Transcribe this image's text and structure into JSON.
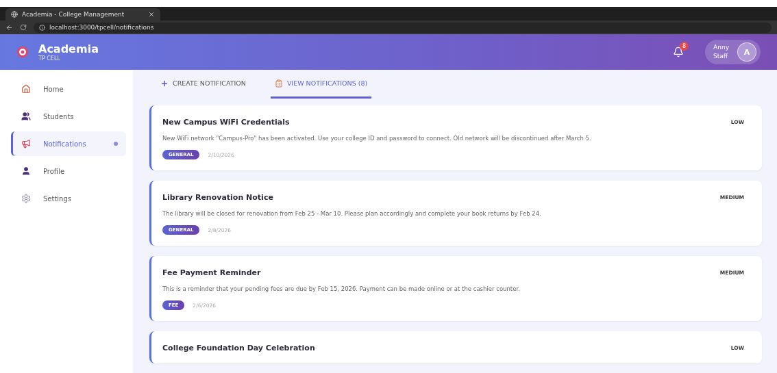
{
  "browser": {
    "tab_title": "Academia - College Management",
    "url": "localhost:3000/tpcell/notifications"
  },
  "header": {
    "app_name": "Academia",
    "subtitle": "TP CELL",
    "notification_count": "8",
    "user": {
      "name": "Anny",
      "role": "Staff",
      "initial": "A"
    }
  },
  "sidebar": {
    "items": [
      {
        "label": "Home",
        "kind": "home",
        "selected": false
      },
      {
        "label": "Students",
        "kind": "students",
        "selected": false
      },
      {
        "label": "Notifications",
        "kind": "notifications",
        "selected": true
      },
      {
        "label": "Profile",
        "kind": "profile",
        "selected": false
      },
      {
        "label": "Settings",
        "kind": "settings",
        "selected": false
      }
    ]
  },
  "tabs": [
    {
      "label": "CREATE NOTIFICATION",
      "kind": "create",
      "selected": false
    },
    {
      "label": "VIEW NOTIFICATIONS (8)",
      "kind": "view",
      "selected": true
    }
  ],
  "notifications": [
    {
      "title": "New Campus WiFi Credentials",
      "priority": "LOW",
      "message": "New WiFi network \"Campus-Pro\" has been activated. Use your college ID and password to connect. Old network will be discontinued after March 5.",
      "category": "GENERAL",
      "date": "2/10/2026"
    },
    {
      "title": "Library Renovation Notice",
      "priority": "MEDIUM",
      "message": "The library will be closed for renovation from Feb 25 - Mar 10. Please plan accordingly and complete your book returns by Feb 24.",
      "category": "GENERAL",
      "date": "2/8/2026"
    },
    {
      "title": "Fee Payment Reminder",
      "priority": "MEDIUM",
      "message": "This is a reminder that your pending fees are due by Feb 15, 2026. Payment can be made online or at the cashier counter.",
      "category": "FEE",
      "date": "2/6/2026"
    },
    {
      "title": "College Foundation Day Celebration",
      "priority": "LOW"
    }
  ]
}
